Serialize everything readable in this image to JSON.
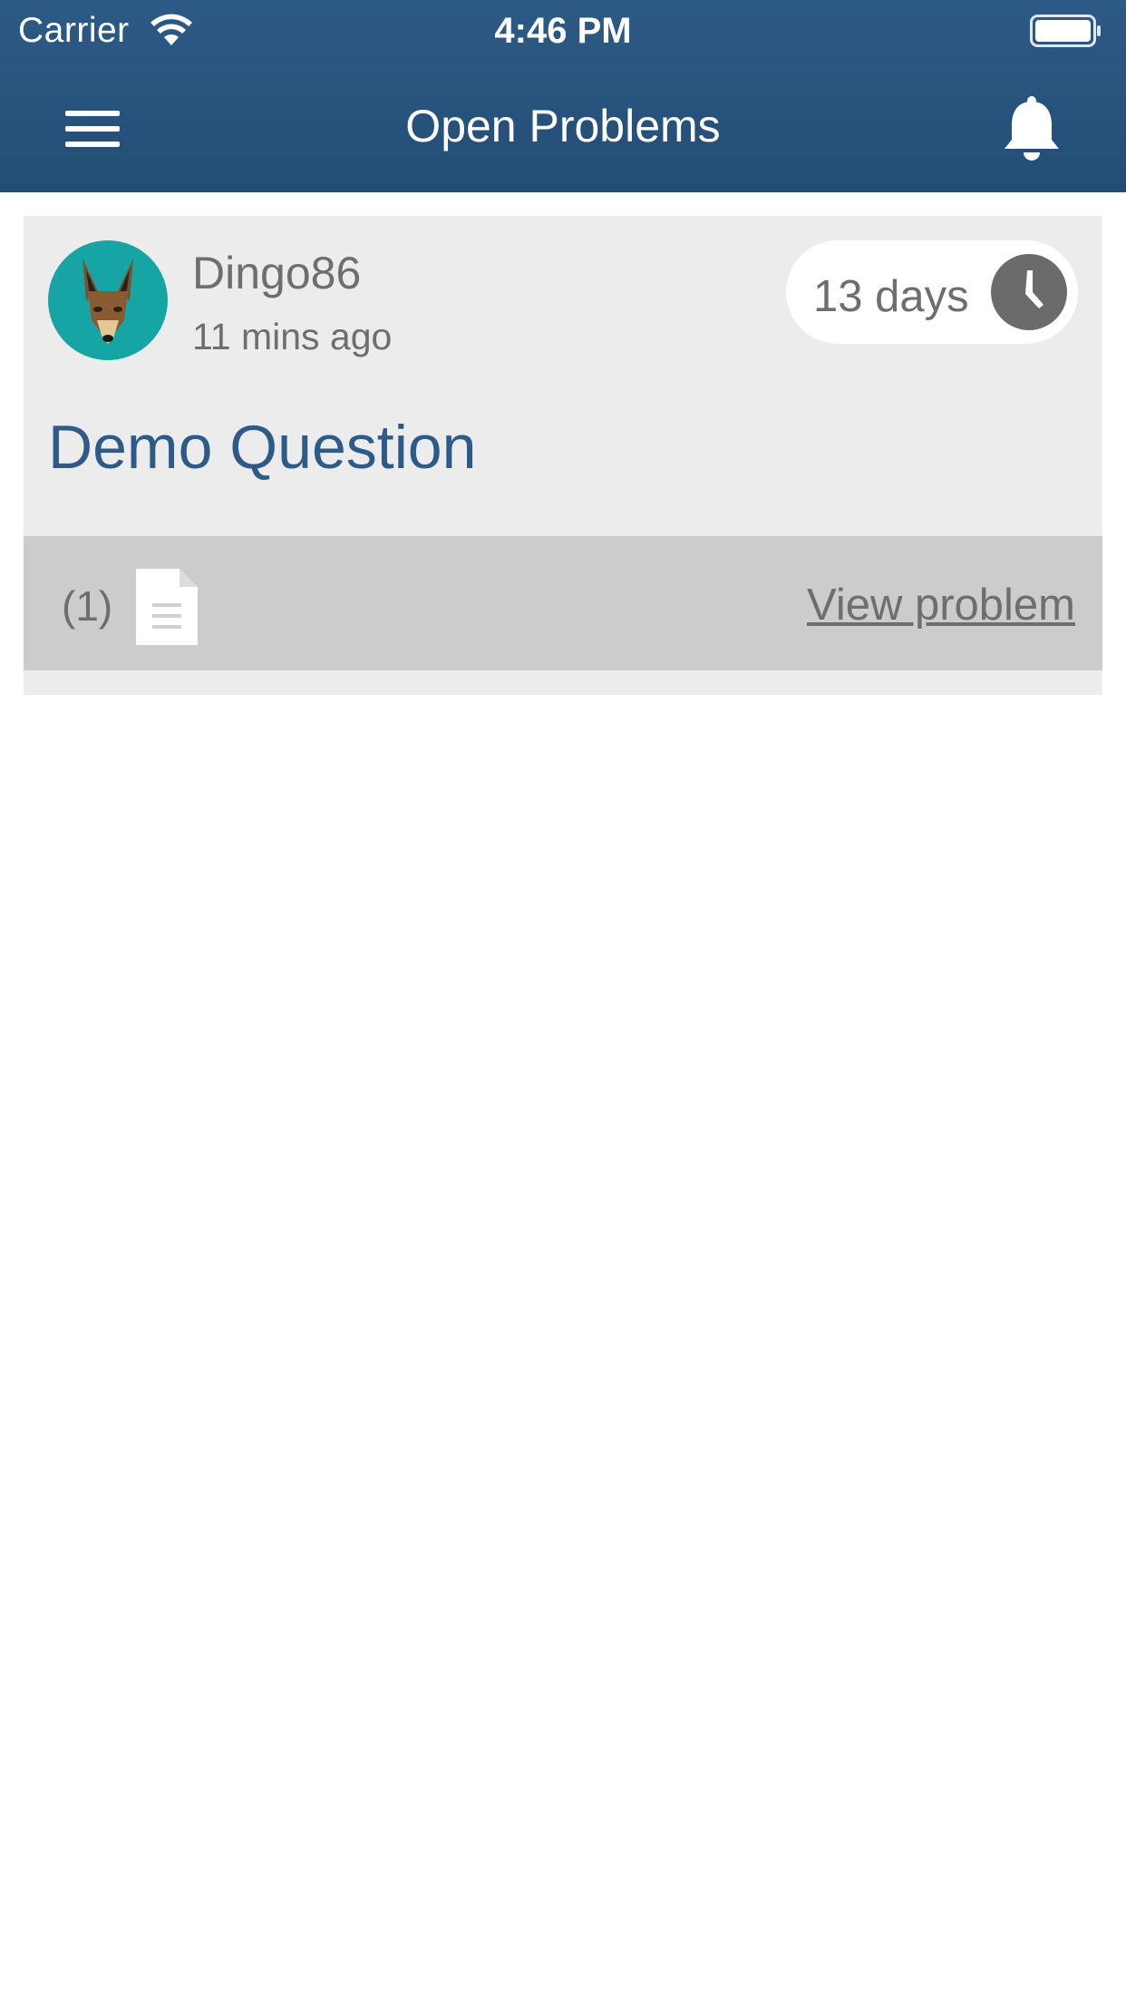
{
  "status_bar": {
    "carrier": "Carrier",
    "time": "4:46 PM",
    "wifi_icon": "wifi-icon",
    "battery_icon": "battery-full-icon"
  },
  "nav": {
    "title": "Open Problems",
    "menu_icon": "hamburger-menu-icon",
    "notifications_icon": "bell-icon"
  },
  "problems": [
    {
      "avatar_icon": "dingo-avatar",
      "username": "Dingo86",
      "posted": "11 mins ago",
      "time_remaining": "13 days",
      "timer_icon": "clock-icon",
      "title": "Demo Question",
      "attachment_count": "(1)",
      "attachment_icon": "document-icon",
      "view_label": "View problem"
    }
  ],
  "colors": {
    "header": "#2a5580",
    "accent_text": "#2d5a86",
    "card_bg": "#ececec",
    "card_footer_bg": "#cccccc",
    "avatar_bg": "#17a4a5"
  }
}
